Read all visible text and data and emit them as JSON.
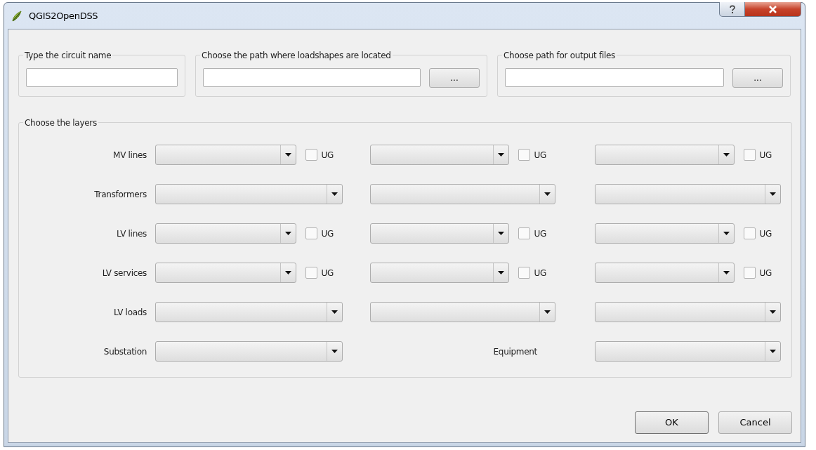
{
  "window": {
    "title": "QGIS2OpenDSS"
  },
  "top_groups": [
    {
      "title": "Type the circuit name"
    },
    {
      "title": "Choose the path where loadshapes are located",
      "browse_button": "..."
    },
    {
      "title": "Choose path for output files",
      "browse_button": "..."
    }
  ],
  "layers": {
    "title": "Choose the layers",
    "rows": [
      {
        "label": "MV lines",
        "cells": [
          {
            "kind": "combo",
            "ug": {
              "label": "UG",
              "checked": false
            }
          },
          {
            "kind": "combo",
            "ug": {
              "label": "UG",
              "checked": false
            }
          },
          {
            "kind": "combo",
            "ug": {
              "label": "UG",
              "checked": false
            }
          }
        ]
      },
      {
        "label": "Transformers",
        "cells": [
          {
            "kind": "combo"
          },
          {
            "kind": "combo"
          },
          {
            "kind": "combo"
          }
        ]
      },
      {
        "label": "LV lines",
        "cells": [
          {
            "kind": "combo",
            "ug": {
              "label": "UG",
              "checked": false
            }
          },
          {
            "kind": "combo",
            "ug": {
              "label": "UG",
              "checked": false
            }
          },
          {
            "kind": "combo",
            "ug": {
              "label": "UG",
              "checked": false
            }
          }
        ]
      },
      {
        "label": "LV services",
        "cells": [
          {
            "kind": "combo",
            "ug": {
              "label": "UG",
              "checked": false
            }
          },
          {
            "kind": "combo",
            "ug": {
              "label": "UG",
              "checked": false
            }
          },
          {
            "kind": "combo",
            "ug": {
              "label": "UG",
              "checked": false
            }
          }
        ]
      },
      {
        "label": "LV loads",
        "cells": [
          {
            "kind": "combo"
          },
          {
            "kind": "combo"
          },
          {
            "kind": "combo"
          }
        ]
      },
      {
        "label": "Substation",
        "cells": [
          {
            "kind": "combo"
          },
          {
            "kind": "label",
            "text": "Equipment"
          },
          {
            "kind": "combo"
          }
        ]
      }
    ]
  },
  "buttons": [
    {
      "label": "OK",
      "default": true
    },
    {
      "label": "Cancel",
      "default": false
    }
  ]
}
